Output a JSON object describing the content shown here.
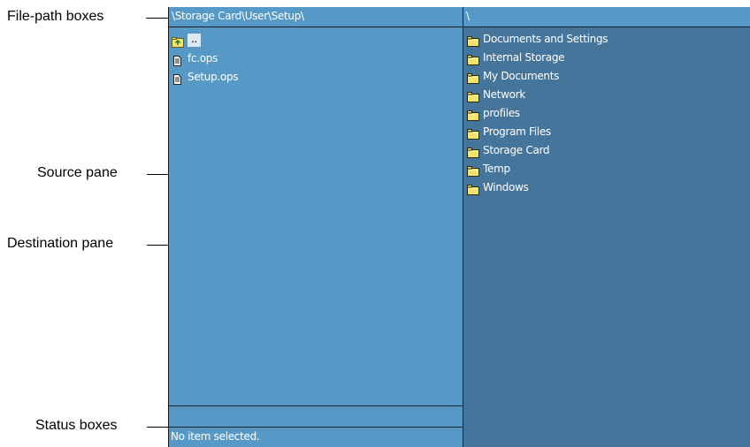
{
  "callouts": {
    "file_path": "File-path boxes",
    "source": "Source pane",
    "destination": "Destination pane",
    "status": "Status boxes"
  },
  "source": {
    "path": "\\Storage Card\\User\\Setup\\",
    "items": [
      {
        "name": "..",
        "icon": "folder-up-icon"
      },
      {
        "name": "fc.ops",
        "icon": "file-icon"
      },
      {
        "name": "Setup.ops",
        "icon": "file-icon"
      }
    ]
  },
  "destination": {
    "path": "\\",
    "items": [
      {
        "name": "Documents and Settings",
        "icon": "folder-icon"
      },
      {
        "name": "Internal Storage",
        "icon": "folder-icon"
      },
      {
        "name": "My Documents",
        "icon": "folder-icon"
      },
      {
        "name": "Network",
        "icon": "folder-icon"
      },
      {
        "name": "profiles",
        "icon": "folder-icon"
      },
      {
        "name": "Program Files",
        "icon": "folder-icon"
      },
      {
        "name": "Storage Card",
        "icon": "folder-icon"
      },
      {
        "name": "Temp",
        "icon": "folder-icon"
      },
      {
        "name": "Windows",
        "icon": "folder-icon"
      }
    ]
  },
  "status": {
    "line1": "",
    "line2": "No item selected."
  },
  "colors": {
    "source_bg": "#5699c7",
    "destination_bg": "#46759c",
    "folder": "#f4e36a",
    "border": "#0f1a24"
  }
}
